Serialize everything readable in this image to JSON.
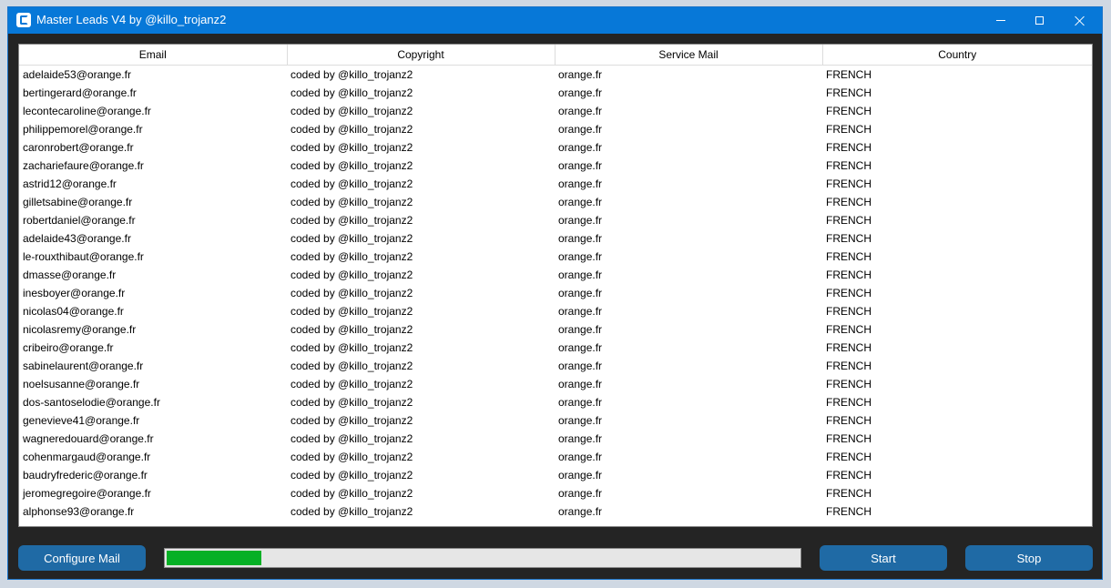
{
  "window": {
    "title": "Master Leads V4 by @killo_trojanz2",
    "accent": "#0778d8"
  },
  "table": {
    "columns": [
      "Email",
      "Copyright",
      "Service Mail",
      "Country"
    ],
    "rows": [
      [
        "adelaide53@orange.fr",
        "coded by @killo_trojanz2",
        "orange.fr",
        "FRENCH"
      ],
      [
        "bertingerard@orange.fr",
        "coded by @killo_trojanz2",
        "orange.fr",
        "FRENCH"
      ],
      [
        "lecontecaroline@orange.fr",
        "coded by @killo_trojanz2",
        "orange.fr",
        "FRENCH"
      ],
      [
        "philippemorel@orange.fr",
        "coded by @killo_trojanz2",
        "orange.fr",
        "FRENCH"
      ],
      [
        "caronrobert@orange.fr",
        "coded by @killo_trojanz2",
        "orange.fr",
        "FRENCH"
      ],
      [
        "zachariefaure@orange.fr",
        "coded by @killo_trojanz2",
        "orange.fr",
        "FRENCH"
      ],
      [
        "astrid12@orange.fr",
        "coded by @killo_trojanz2",
        "orange.fr",
        "FRENCH"
      ],
      [
        "gilletsabine@orange.fr",
        "coded by @killo_trojanz2",
        "orange.fr",
        "FRENCH"
      ],
      [
        "robertdaniel@orange.fr",
        "coded by @killo_trojanz2",
        "orange.fr",
        "FRENCH"
      ],
      [
        "adelaide43@orange.fr",
        "coded by @killo_trojanz2",
        "orange.fr",
        "FRENCH"
      ],
      [
        "le-rouxthibaut@orange.fr",
        "coded by @killo_trojanz2",
        "orange.fr",
        "FRENCH"
      ],
      [
        "dmasse@orange.fr",
        "coded by @killo_trojanz2",
        "orange.fr",
        "FRENCH"
      ],
      [
        "inesboyer@orange.fr",
        "coded by @killo_trojanz2",
        "orange.fr",
        "FRENCH"
      ],
      [
        "nicolas04@orange.fr",
        "coded by @killo_trojanz2",
        "orange.fr",
        "FRENCH"
      ],
      [
        "nicolasremy@orange.fr",
        "coded by @killo_trojanz2",
        "orange.fr",
        "FRENCH"
      ],
      [
        "cribeiro@orange.fr",
        "coded by @killo_trojanz2",
        "orange.fr",
        "FRENCH"
      ],
      [
        "sabinelaurent@orange.fr",
        "coded by @killo_trojanz2",
        "orange.fr",
        "FRENCH"
      ],
      [
        "noelsusanne@orange.fr",
        "coded by @killo_trojanz2",
        "orange.fr",
        "FRENCH"
      ],
      [
        "dos-santoselodie@orange.fr",
        "coded by @killo_trojanz2",
        "orange.fr",
        "FRENCH"
      ],
      [
        "genevieve41@orange.fr",
        "coded by @killo_trojanz2",
        "orange.fr",
        "FRENCH"
      ],
      [
        "wagneredouard@orange.fr",
        "coded by @killo_trojanz2",
        "orange.fr",
        "FRENCH"
      ],
      [
        "cohenmargaud@orange.fr",
        "coded by @killo_trojanz2",
        "orange.fr",
        "FRENCH"
      ],
      [
        "baudryfrederic@orange.fr",
        "coded by @killo_trojanz2",
        "orange.fr",
        "FRENCH"
      ],
      [
        "jeromegregoire@orange.fr",
        "coded by @killo_trojanz2",
        "orange.fr",
        "FRENCH"
      ],
      [
        "alphonse93@orange.fr",
        "coded by @killo_trojanz2",
        "orange.fr",
        "FRENCH"
      ]
    ]
  },
  "controls": {
    "configure_label": "Configure Mail",
    "start_label": "Start",
    "stop_label": "Stop",
    "button_color": "#1f6aa5",
    "progress_fraction": 0.15,
    "progress_color": "#06b025"
  }
}
